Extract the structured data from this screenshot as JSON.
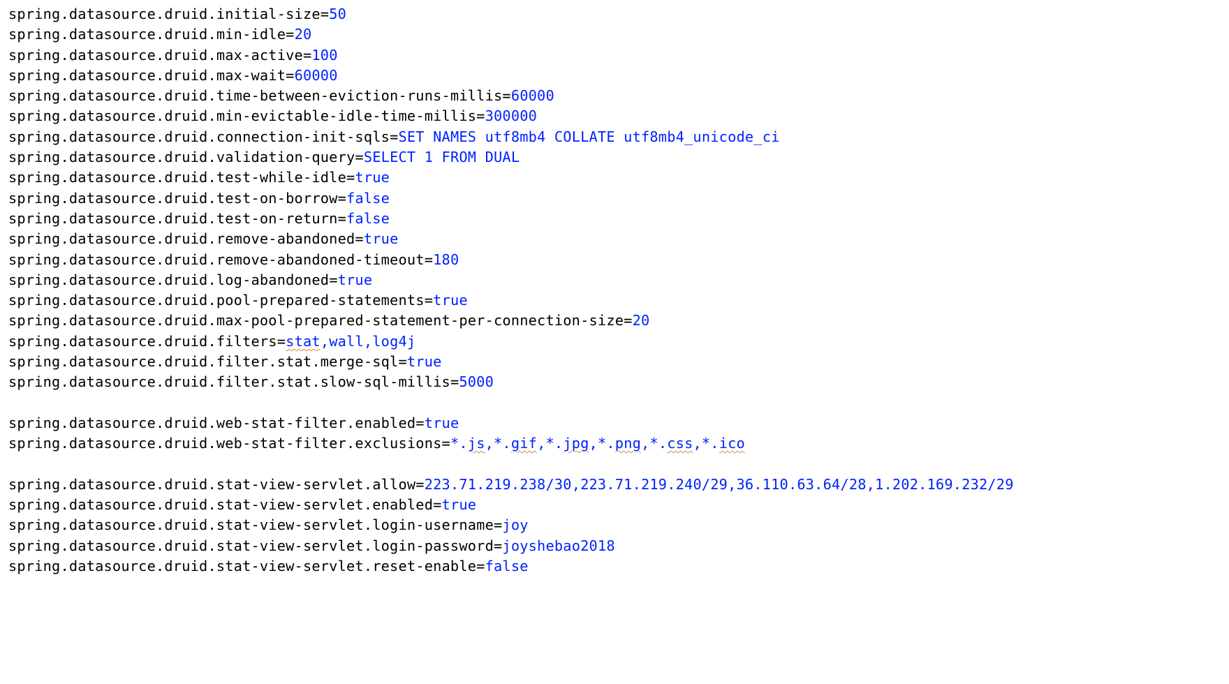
{
  "lines": [
    {
      "key": "spring.datasource.druid.initial-size",
      "segments": [
        {
          "text": "50"
        }
      ]
    },
    {
      "key": "spring.datasource.druid.min-idle",
      "segments": [
        {
          "text": "20"
        }
      ]
    },
    {
      "key": "spring.datasource.druid.max-active",
      "segments": [
        {
          "text": "100"
        }
      ]
    },
    {
      "key": "spring.datasource.druid.max-wait",
      "segments": [
        {
          "text": "60000"
        }
      ]
    },
    {
      "key": "spring.datasource.druid.time-between-eviction-runs-millis",
      "segments": [
        {
          "text": "60000"
        }
      ]
    },
    {
      "key": "spring.datasource.druid.min-evictable-idle-time-millis",
      "segments": [
        {
          "text": "300000"
        }
      ]
    },
    {
      "key": "spring.datasource.druid.connection-init-sqls",
      "segments": [
        {
          "text": "SET NAMES utf8mb4 COLLATE utf8mb4_unicode_ci"
        }
      ]
    },
    {
      "key": "spring.datasource.druid.validation-query",
      "segments": [
        {
          "text": "SELECT 1 FROM DUAL"
        }
      ]
    },
    {
      "key": "spring.datasource.druid.test-while-idle",
      "segments": [
        {
          "text": "true"
        }
      ]
    },
    {
      "key": "spring.datasource.druid.test-on-borrow",
      "segments": [
        {
          "text": "false"
        }
      ]
    },
    {
      "key": "spring.datasource.druid.test-on-return",
      "segments": [
        {
          "text": "false"
        }
      ]
    },
    {
      "key": "spring.datasource.druid.remove-abandoned",
      "segments": [
        {
          "text": "true"
        }
      ]
    },
    {
      "key": "spring.datasource.druid.remove-abandoned-timeout",
      "segments": [
        {
          "text": "180"
        }
      ]
    },
    {
      "key": "spring.datasource.druid.log-abandoned",
      "segments": [
        {
          "text": "true"
        }
      ]
    },
    {
      "key": "spring.datasource.druid.pool-prepared-statements",
      "segments": [
        {
          "text": "true"
        }
      ]
    },
    {
      "key": "spring.datasource.druid.max-pool-prepared-statement-per-connection-size",
      "segments": [
        {
          "text": "20"
        }
      ]
    },
    {
      "key": "spring.datasource.druid.filters",
      "segments": [
        {
          "text": "stat",
          "squiggle": true
        },
        {
          "text": ",wall,log4j"
        }
      ]
    },
    {
      "key": "spring.datasource.druid.filter.stat.merge-sql",
      "segments": [
        {
          "text": "true"
        }
      ]
    },
    {
      "key": "spring.datasource.druid.filter.stat.slow-sql-millis",
      "segments": [
        {
          "text": "5000"
        }
      ]
    },
    {
      "blank": true
    },
    {
      "key": "spring.datasource.druid.web-stat-filter.enabled",
      "segments": [
        {
          "text": "true"
        }
      ]
    },
    {
      "key": "spring.datasource.druid.web-stat-filter.exclusions",
      "segments": [
        {
          "text": "*."
        },
        {
          "text": "js",
          "squiggle": true
        },
        {
          "text": ",*."
        },
        {
          "text": "gif",
          "squiggle": true
        },
        {
          "text": ",*."
        },
        {
          "text": "jpg",
          "squiggle": true
        },
        {
          "text": ",*."
        },
        {
          "text": "png",
          "squiggle": true
        },
        {
          "text": ",*."
        },
        {
          "text": "css",
          "squiggle": true
        },
        {
          "text": ",*."
        },
        {
          "text": "ico",
          "squiggle": true
        }
      ]
    },
    {
      "blank": true
    },
    {
      "key": "spring.datasource.druid.stat-view-servlet.allow",
      "segments": [
        {
          "text": "223.71.219.238/30,223.71.219.240/29,36.110.63.64/28,1.202.169.232/29"
        }
      ]
    },
    {
      "key": "spring.datasource.druid.stat-view-servlet.enabled",
      "segments": [
        {
          "text": "true"
        }
      ]
    },
    {
      "key": "spring.datasource.druid.stat-view-servlet.login-username",
      "segments": [
        {
          "text": "joy"
        }
      ]
    },
    {
      "key": "spring.datasource.druid.stat-view-servlet.login-password",
      "segments": [
        {
          "text": "joyshebao2018"
        }
      ]
    },
    {
      "key": "spring.datasource.druid.stat-view-servlet.reset-enable",
      "segments": [
        {
          "text": "false"
        }
      ]
    }
  ]
}
